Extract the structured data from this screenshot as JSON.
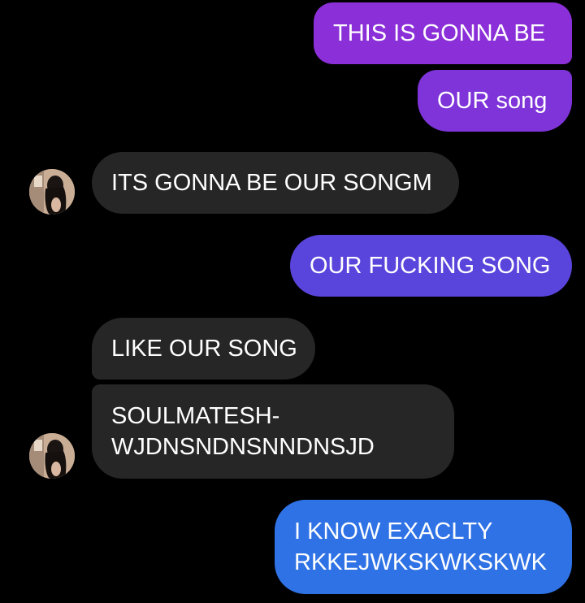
{
  "conversation": {
    "messages": [
      {
        "sender": "me",
        "text": "THIS IS GONNA BE",
        "color": "#8b2fd8"
      },
      {
        "sender": "me",
        "text": "OUR song",
        "color": "#7e34d9"
      },
      {
        "sender": "them",
        "text": "ITS GONNA BE OUR SONGM"
      },
      {
        "sender": "me",
        "text": "OUR FUCKING SONG",
        "color": "#5a45dc"
      },
      {
        "sender": "them",
        "text": "LIKE OUR SONG"
      },
      {
        "sender": "them",
        "lines": [
          "SOULMATESH-",
          "WJDNSNDNSNNDNSJD"
        ]
      },
      {
        "sender": "me",
        "lines": [
          "I KNOW EXACLTY",
          "RKKEJWKSKWKSKWK"
        ],
        "color": "#2f72e6"
      }
    ]
  },
  "theme": {
    "background": "#000000",
    "received_bubble": "#262626",
    "text": "#ffffff"
  },
  "icons": {
    "avatar": "contact-avatar-photo"
  }
}
